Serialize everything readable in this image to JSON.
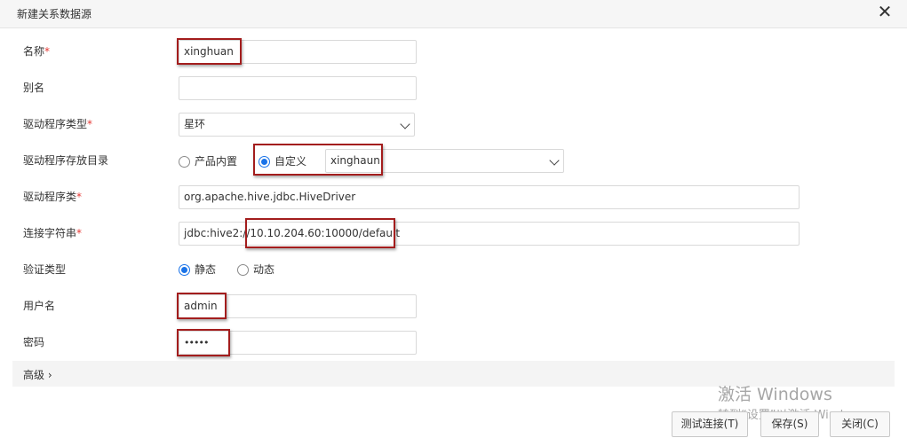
{
  "dialog": {
    "title": "新建关系数据源",
    "close_glyph": "✕"
  },
  "form": {
    "name": {
      "label": "名称",
      "required": "*",
      "value": "xinghuan"
    },
    "alias": {
      "label": "别名",
      "value": ""
    },
    "driver_type": {
      "label": "驱动程序类型",
      "required": "*",
      "value": "星环"
    },
    "driver_dir": {
      "label": "驱动程序存放目录",
      "option_builtin": "产品内置",
      "option_custom": "自定义",
      "selected": "自定义",
      "custom_value": "xinghaun"
    },
    "driver_class": {
      "label": "驱动程序类",
      "required": "*",
      "value": "org.apache.hive.jdbc.HiveDriver"
    },
    "conn_string": {
      "label": "连接字符串",
      "required": "*",
      "value": "jdbc:hive2://10.10.204.60:10000/default"
    },
    "auth_type": {
      "label": "验证类型",
      "option_static": "静态",
      "option_dynamic": "动态",
      "selected": "静态"
    },
    "username": {
      "label": "用户名",
      "value": "admin"
    },
    "password": {
      "label": "密码",
      "value": "•••••"
    }
  },
  "advanced": {
    "label": "高级 ›"
  },
  "buttons": {
    "test": "测试连接(T)",
    "save": "保存(S)",
    "close": "关闭(C)"
  },
  "watermark": {
    "line1": "激活 Windows",
    "line2": "转到“设置”以激活 Windows。"
  },
  "colors": {
    "accent": "#1a73e8",
    "highlight": "#a31d1d",
    "required": "#e53935"
  }
}
